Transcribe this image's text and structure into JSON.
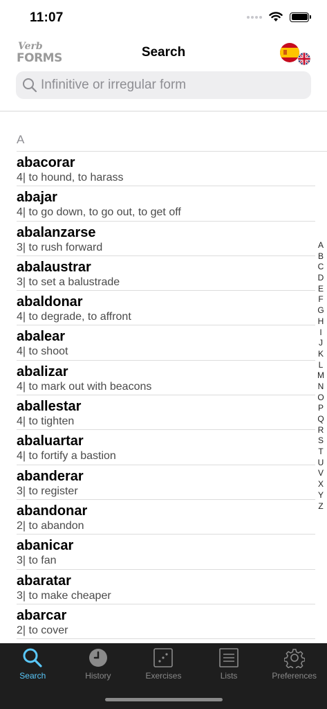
{
  "status": {
    "time": "11:07"
  },
  "header": {
    "logo_line1": "Verb",
    "logo_line2": "FORMS",
    "title": "Search"
  },
  "search": {
    "placeholder": "Infinitive or irregular form",
    "icon": "search-icon"
  },
  "list": {
    "section": "A",
    "rows": [
      {
        "word": "abacorar",
        "meaning": "4| to hound, to harass"
      },
      {
        "word": "abajar",
        "meaning": "4| to go down, to go out, to get off"
      },
      {
        "word": "abalanzarse",
        "meaning": "3| to rush forward"
      },
      {
        "word": "abalaustrar",
        "meaning": "3| to set a balustrade"
      },
      {
        "word": "abaldonar",
        "meaning": "4| to degrade, to affront"
      },
      {
        "word": "abalear",
        "meaning": "4| to shoot"
      },
      {
        "word": "abalizar",
        "meaning": "4| to mark out with beacons"
      },
      {
        "word": "aballestar",
        "meaning": "4| to tighten"
      },
      {
        "word": "abaluartar",
        "meaning": "4| to fortify a bastion"
      },
      {
        "word": "abanderar",
        "meaning": "3| to register"
      },
      {
        "word": "abandonar",
        "meaning": "2| to abandon"
      },
      {
        "word": "abanicar",
        "meaning": "3| to fan"
      },
      {
        "word": "abaratar",
        "meaning": "3| to make cheaper"
      },
      {
        "word": "abarcar",
        "meaning": "2| to cover"
      }
    ]
  },
  "index_letters": [
    "A",
    "B",
    "C",
    "D",
    "E",
    "F",
    "G",
    "H",
    "I",
    "J",
    "K",
    "L",
    "M",
    "N",
    "O",
    "P",
    "Q",
    "R",
    "S",
    "T",
    "U",
    "V",
    "X",
    "Y",
    "Z"
  ],
  "tabs": [
    {
      "label": "Search",
      "icon": "search-icon",
      "active": true
    },
    {
      "label": "History",
      "icon": "clock-icon",
      "active": false
    },
    {
      "label": "Exercises",
      "icon": "dice-icon",
      "active": false
    },
    {
      "label": "Lists",
      "icon": "list-icon",
      "active": false
    },
    {
      "label": "Preferences",
      "icon": "gear-icon",
      "active": false
    }
  ],
  "colors": {
    "accent": "#5ac8fa",
    "tabbar_bg": "#1e1e1e",
    "search_bg": "#eeeef0"
  }
}
